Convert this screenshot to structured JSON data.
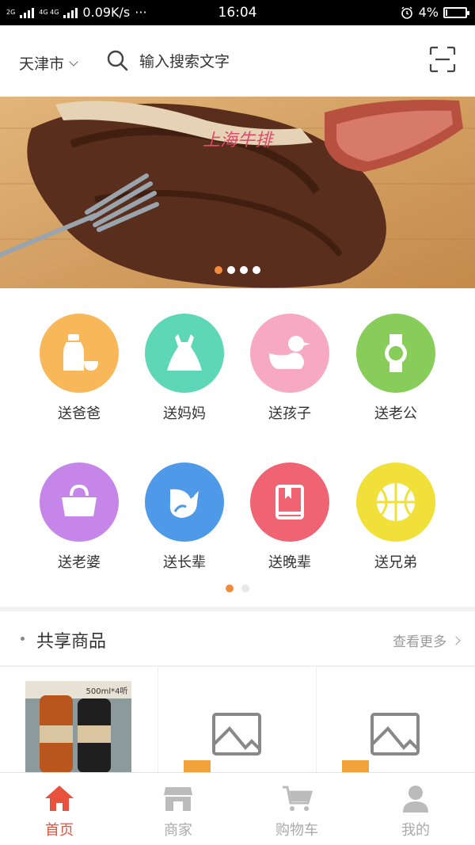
{
  "status_bar": {
    "net_tag_1": "2G",
    "net_tag_2": "4G 4G",
    "speed": "0.09K/s",
    "more": "···",
    "time": "16:04",
    "battery": "4%"
  },
  "header": {
    "city": "天津市",
    "search_placeholder": "输入搜索文字"
  },
  "banner": {
    "slide_count": 4,
    "active_index": 0,
    "overlay_text": "上海牛排"
  },
  "categories": {
    "items": [
      {
        "label": "送爸爸",
        "icon": "bottle-icon",
        "color": "#f8b758"
      },
      {
        "label": "送妈妈",
        "icon": "dress-icon",
        "color": "#5ed7b6"
      },
      {
        "label": "送孩子",
        "icon": "duck-icon",
        "color": "#f7a9c4"
      },
      {
        "label": "送老公",
        "icon": "watch-icon",
        "color": "#88cc5a"
      },
      {
        "label": "送老婆",
        "icon": "handbag-icon",
        "color": "#c685e8"
      },
      {
        "label": "送长辈",
        "icon": "bird-icon",
        "color": "#4f9ae8"
      },
      {
        "label": "送晚辈",
        "icon": "book-icon",
        "color": "#f06373"
      },
      {
        "label": "送兄弟",
        "icon": "basketball-icon",
        "color": "#f2e03a"
      }
    ],
    "page_count": 2,
    "active_page": 0
  },
  "section": {
    "title": "共享商品",
    "more": "查看更多"
  },
  "products": {
    "first_label": "500ml*4听"
  },
  "bottom_nav": {
    "items": [
      {
        "label": "首页",
        "icon": "home-icon",
        "active": true
      },
      {
        "label": "商家",
        "icon": "shop-icon",
        "active": false
      },
      {
        "label": "购物车",
        "icon": "cart-icon",
        "active": false
      },
      {
        "label": "我的",
        "icon": "user-icon",
        "active": false
      }
    ]
  },
  "colors": {
    "accent": "#e8513d",
    "dot_active": "#f08c3c"
  }
}
